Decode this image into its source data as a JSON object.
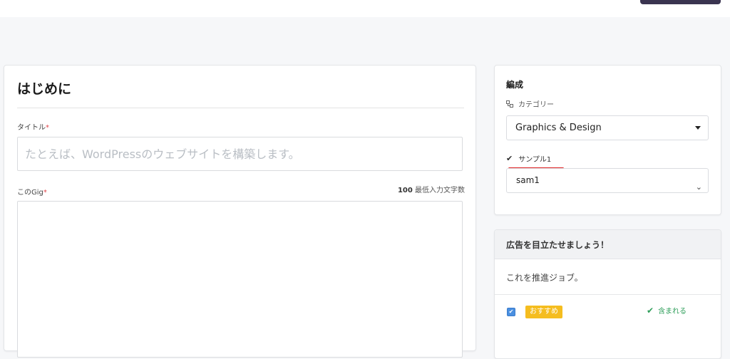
{
  "intro": {
    "title": "はじめに",
    "title_label": "タイトル",
    "required_mark": "*",
    "title_placeholder": "たとえば、WordPressのウェブサイトを構築します。",
    "gig_label": "このGig",
    "min_chars_count": "100",
    "min_chars_text": "最低入力文字数"
  },
  "composition": {
    "title": "編成",
    "category_label": "カテゴリー",
    "category_icon": "category-icon",
    "category_value": "Graphics & Design",
    "sample_label": "サンプル1",
    "sample_value": "sam1",
    "sample_underline_color": "#e02424"
  },
  "promo": {
    "title": "広告を目立たせましょう！",
    "text": "これを推進ジョブ。",
    "badge": "おすすめ",
    "badge_color": "#f5bd1f",
    "included": "含まれる",
    "included_color": "#2e9e5a"
  }
}
